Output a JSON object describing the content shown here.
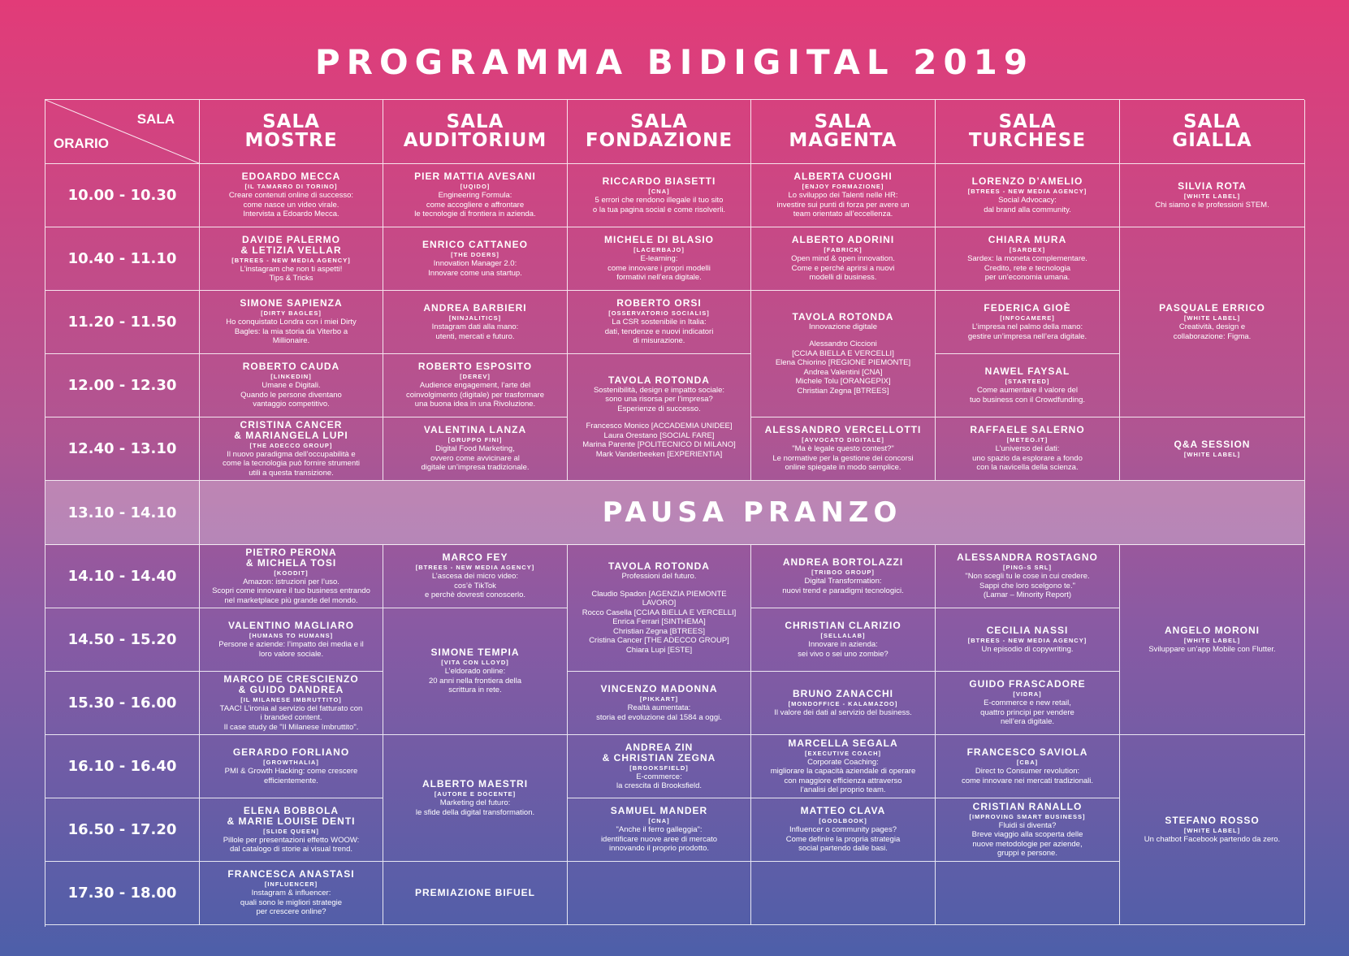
{
  "title": "PROGRAMMA BIDIGITAL 2019",
  "corner": {
    "sala": "SALA",
    "orario": "ORARIO"
  },
  "rooms": [
    [
      "SALA",
      "MOSTRE"
    ],
    [
      "SALA",
      "AUDITORIUM"
    ],
    [
      "SALA",
      "FONDAZIONE"
    ],
    [
      "SALA",
      "MAGENTA"
    ],
    [
      "SALA",
      "TURCHESE"
    ],
    [
      "SALA",
      "GIALLA"
    ]
  ],
  "times": [
    "10.00 - 10.30",
    "10.40 - 11.10",
    "11.20 - 11.50",
    "12.00 - 12.30",
    "12.40 - 13.10",
    "13.10 - 14.10",
    "14.10 - 14.40",
    "14.50 - 15.20",
    "15.30 - 16.00",
    "16.10 - 16.40",
    "16.50 - 17.20",
    "17.30 - 18.00"
  ],
  "lunch": "PAUSA PRANZO",
  "sessions": {
    "mostre_1": {
      "name": [
        "EDOARDO MECCA"
      ],
      "company": "[IL TAMARRO DI TORINO]",
      "desc": [
        "Creare contenuti online di successo:",
        "come nasce un video virale.",
        "Intervista a Edoardo Mecca."
      ]
    },
    "mostre_2": {
      "name": [
        "DAVIDE PALERMO",
        "& LETIZIA VELLAR"
      ],
      "company": "[BTREES - NEW MEDIA AGENCY]",
      "desc": [
        "L’instagram che non ti aspetti!",
        "Tips & Tricks"
      ]
    },
    "mostre_3": {
      "name": [
        "SIMONE SAPIENZA"
      ],
      "company": "[DIRTY BAGLES]",
      "desc": [
        "Ho conquistato Londra con i miei Dirty",
        "Bagles: la mia storia da Viterbo a",
        "Millionaire."
      ]
    },
    "mostre_4": {
      "name": [
        "ROBERTO CAUDA"
      ],
      "company": "[LINKEDIN]",
      "desc": [
        "Umane e Digitali.",
        "Quando le persone diventano",
        "vantaggio competitivo."
      ]
    },
    "mostre_5": {
      "name": [
        "CRISTINA CANCER",
        "& MARIANGELA LUPI"
      ],
      "company": "[THE ADECCO GROUP]",
      "desc": [
        "Il nuovo paradigma dell’occupabilità e",
        "come la tecnologia può fornire strumenti",
        "utili a questa transizione."
      ]
    },
    "mostre_7": {
      "name": [
        "PIETRO PERONA",
        "& MICHELA TOSI"
      ],
      "company": "[KOODIT]",
      "desc": [
        "Amazon: istruzioni per l’uso.",
        "Scopri come innovare il tuo business entrando",
        "nel marketplace più grande del mondo."
      ]
    },
    "mostre_8": {
      "name": [
        "VALENTINO MAGLIARO"
      ],
      "company": "[HUMANS TO HUMANS]",
      "desc": [
        "Persone e aziende: l’impatto dei media e il",
        "loro valore sociale."
      ]
    },
    "mostre_9": {
      "name": [
        "MARCO DE CRESCIENZO",
        "& GUIDO DANDREA"
      ],
      "company": "[IL MILANESE IMBRUTTITO]",
      "desc": [
        "TAAC! L’ironia al servizio del fatturato con",
        "i branded content.",
        "Il case study de \"Il Milanese Imbruttito\"."
      ]
    },
    "mostre_10": {
      "name": [
        "GERARDO FORLIANO"
      ],
      "company": "[GROWTHALIA]",
      "desc": [
        "PMI & Growth Hacking: come crescere",
        "efficientemente."
      ]
    },
    "mostre_11": {
      "name": [
        "ELENA BOBBOLA",
        "& MARIE LOUISE DENTI"
      ],
      "company": "[SLIDE QUEEN]",
      "desc": [
        "Pillole per presentazioni effetto WOOW:",
        "dal catalogo di storie ai visual trend."
      ]
    },
    "mostre_12": {
      "name": [
        "FRANCESCA ANASTASI"
      ],
      "company": "[INFLUENCER]",
      "desc": [
        "Instagram & influencer:",
        "quali sono le migliori strategie",
        "per crescere online?"
      ]
    },
    "aud_1": {
      "name": [
        "PIER MATTIA AVESANI"
      ],
      "company": "[UQIDO]",
      "desc": [
        "Engineering Formula:",
        "come accogliere e affrontare",
        "le tecnologie di frontiera in azienda."
      ]
    },
    "aud_2": {
      "name": [
        "ENRICO CATTANEO"
      ],
      "company": "[THE DOERS]",
      "desc": [
        "Innovation Manager 2.0:",
        "Innovare come una startup."
      ]
    },
    "aud_3": {
      "name": [
        "ANDREA BARBIERI"
      ],
      "company": "[NINJALITICS]",
      "desc": [
        "Instagram dati alla mano:",
        "utenti, mercati e futuro."
      ]
    },
    "aud_4": {
      "name": [
        "ROBERTO ESPOSITO"
      ],
      "company": "[DEREV]",
      "desc": [
        "Audience engagement, l’arte del",
        "coinvolgimento (digitale) per trasformare",
        "una buona idea in una Rivoluzione."
      ]
    },
    "aud_5": {
      "name": [
        "VALENTINA LANZA"
      ],
      "company": "[GRUPPO FINI]",
      "desc": [
        "Digital Food Marketing,",
        "ovvero come avvicinare al",
        "digitale un’impresa tradizionale."
      ]
    },
    "aud_7": {
      "name": [
        "MARCO FEY"
      ],
      "company": "[BTREES - NEW MEDIA AGENCY]",
      "desc": [
        "L’ascesa dei micro video:",
        "cos’è TikTok",
        "e perchè dovresti conoscerlo."
      ]
    },
    "aud_8": {
      "name": [
        "SIMONE TEMPIA"
      ],
      "company": "[VITA CON LLOYD]",
      "desc": [
        "L’eldorado online:",
        "20 anni nella frontiera della",
        "scrittura in rete."
      ]
    },
    "aud_10": {
      "name": [
        "ALBERTO MAESTRI"
      ],
      "company": "[AUTORE E DOCENTE]",
      "desc": [
        "Marketing del futuro:",
        "le sfide della digital transformation."
      ]
    },
    "aud_12": {
      "name": [
        "PREMIAZIONE BIFUEL"
      ],
      "company": "",
      "desc": []
    },
    "fond_1": {
      "name": [
        "RICCARDO BIASETTI"
      ],
      "company": "[CNA]",
      "desc": [
        "5 errori che rendono illegale il tuo sito",
        "o la tua pagina social e come risolverli."
      ]
    },
    "fond_2": {
      "name": [
        "MICHELE DI BLASIO"
      ],
      "company": "[LACERBAJO]",
      "desc": [
        "E-learning:",
        "come innovare i propri modelli",
        "formativi nell’era digitale."
      ]
    },
    "fond_3": {
      "name": [
        "ROBERTO ORSI"
      ],
      "company": "[OSSERVATORIO SOCIALIS]",
      "desc": [
        "La CSR sostenibile in Italia:",
        "dati, tendenze e nuovi indicatori",
        "di misurazione."
      ]
    },
    "fond_4": {
      "name": [
        "TAVOLA ROTONDA"
      ],
      "company": "",
      "desc": [
        "Sostenibilità, design e impatto sociale:",
        "sono una risorsa per l’impresa?",
        "Esperienze di successo.",
        "",
        "Francesco Monico [ACCADEMIA UNIDEE]",
        "Laura Orestano [SOCIAL FARE]",
        "Marina Parente [POLITECNICO DI MILANO]",
        "Mark Vanderbeeken [EXPERIENTIA]"
      ]
    },
    "fond_7": {
      "name": [
        "TAVOLA ROTONDA"
      ],
      "company": "",
      "desc": [
        "Professioni del futuro.",
        "",
        "Claudio Spadon [AGENZIA PIEMONTE",
        "LAVORO]",
        "Rocco Casella [CCIAA BIELLA E VERCELLI]",
        "Enrica Ferrari [SINTHEMA]",
        "Christian Zegna [BTREES]",
        "Cristina Cancer [THE ADECCO GROUP]",
        "Chiara Lupi [ESTE]"
      ]
    },
    "fond_9": {
      "name": [
        "VINCENZO MADONNA"
      ],
      "company": "[PIKKART]",
      "desc": [
        "Realtà aumentata:",
        "storia ed evoluzione dal 1584 a oggi."
      ]
    },
    "fond_10": {
      "name": [
        "ANDREA ZIN",
        "& CHRISTIAN ZEGNA"
      ],
      "company": "[BROOKSFIELD]",
      "desc": [
        "E-commerce:",
        "la crescita di Brooksfield."
      ]
    },
    "fond_11": {
      "name": [
        "SAMUEL MANDER"
      ],
      "company": "[CNA]",
      "desc": [
        "\"Anche il ferro galleggia\":",
        "identificare nuove aree di mercato",
        "innovando il proprio prodotto."
      ]
    },
    "mag_1": {
      "name": [
        "ALBERTA CUOGHI"
      ],
      "company": "[ENJOY FORMAZIONE]",
      "desc": [
        "Lo sviluppo dei Talenti nelle HR:",
        "investire sui punti di forza per avere un",
        "team orientato all’eccellenza."
      ]
    },
    "mag_2": {
      "name": [
        "ALBERTO ADORINI"
      ],
      "company": "[FABRICK]",
      "desc": [
        "Open mind & open innovation.",
        "Come e perché aprirsi a nuovi",
        "modelli di business."
      ]
    },
    "mag_3": {
      "name": [
        "TAVOLA ROTONDA"
      ],
      "company": "",
      "desc": [
        "Innovazione digitale",
        "",
        "Alessandro Ciccioni",
        "[CCIAA BIELLA E VERCELLI]",
        "Elena Chiorino [REGIONE PIEMONTE]",
        "Andrea Valentini [CNA]",
        "Michele Tolu [ORANGEPIX]",
        "Christian Zegna [BTREES]"
      ]
    },
    "mag_5": {
      "name": [
        "ALESSANDRO VERCELLOTTI"
      ],
      "company": "[AVVOCATO DIGITALE]",
      "desc": [
        "\"Ma è legale questo contest?\"",
        "Le normative per la gestione dei concorsi",
        "online spiegate in modo semplice."
      ]
    },
    "mag_7": {
      "name": [
        "ANDREA BORTOLAZZI"
      ],
      "company": "[TRIBOO GROUP]",
      "desc": [
        "Digital Transformation:",
        "nuovi trend e paradigmi tecnologici."
      ]
    },
    "mag_8": {
      "name": [
        "CHRISTIAN CLARIZIO"
      ],
      "company": "[SELLALAB]",
      "desc": [
        "Innovare in azienda:",
        "sei vivo o sei uno zombie?"
      ]
    },
    "mag_9": {
      "name": [
        "BRUNO ZANACCHI"
      ],
      "company": "[MONDOFFICE - KALAMAZOO]",
      "desc": [
        "Il valore dei dati al servizio del business."
      ]
    },
    "mag_10": {
      "name": [
        "MARCELLA SEGALA"
      ],
      "company": "[EXECUTIVE COACH]",
      "desc": [
        "Corporate Coaching:",
        "migliorare la capacità aziendale di operare",
        "con maggiore efficienza attraverso",
        "l’analisi del proprio team."
      ]
    },
    "mag_11": {
      "name": [
        "MATTEO CLAVA"
      ],
      "company": "[GOOLBOOK]",
      "desc": [
        "Influencer o community pages?",
        "Come definire la propria strategia",
        "social partendo dalle basi."
      ]
    },
    "turch_1": {
      "name": [
        "LORENZO D’AMELIO"
      ],
      "company": "[BTREES - NEW MEDIA AGENCY]",
      "desc": [
        "Social Advocacy:",
        "dal brand alla community."
      ]
    },
    "turch_2": {
      "name": [
        "CHIARA MURA"
      ],
      "company": "[SARDEX]",
      "desc": [
        "Sardex: la moneta complementare.",
        "Credito, rete e tecnologia",
        "per un’economia umana."
      ]
    },
    "turch_3": {
      "name": [
        "FEDERICA GIOÈ"
      ],
      "company": "[INFOCAMERE]",
      "desc": [
        "L’impresa nel palmo della mano:",
        "gestire un’impresa nell’era digitale."
      ]
    },
    "turch_4": {
      "name": [
        "NAWEL FAYSAL"
      ],
      "company": "[STARTEED]",
      "desc": [
        "Come aumentare il valore del",
        "tuo business con il Crowdfunding."
      ]
    },
    "turch_5": {
      "name": [
        "RAFFAELE SALERNO"
      ],
      "company": "[METEO.IT]",
      "desc": [
        "L’universo dei dati:",
        "uno spazio da esplorare a fondo",
        "con la navicella della scienza."
      ]
    },
    "turch_7": {
      "name": [
        "ALESSANDRA ROSTAGNO"
      ],
      "company": "[PING-S SRL]",
      "desc": [
        "\"Non scegli tu le cose in cui credere.",
        "Sappi che loro scelgono te.\"",
        "(Lamar – Minority Report)"
      ]
    },
    "turch_8": {
      "name": [
        "CECILIA NASSI"
      ],
      "company": "[BTREES - NEW MEDIA AGENCY]",
      "desc": [
        "Un episodio di copywriting."
      ]
    },
    "turch_9": {
      "name": [
        "GUIDO FRASCADORE"
      ],
      "company": "[VIDRA]",
      "desc": [
        "E-commerce e new retail,",
        "quattro principi per vendere",
        "nell’era digitale."
      ]
    },
    "turch_10": {
      "name": [
        "FRANCESCO SAVIOLA"
      ],
      "company": "[CBA]",
      "desc": [
        "Direct to Consumer revolution:",
        "come innovare nei mercati tradizionali."
      ]
    },
    "turch_11": {
      "name": [
        "CRISTIAN RANALLO"
      ],
      "company": "[IMPROVING SMART BUSINESS]",
      "desc": [
        "Fluidi si diventa?",
        "Breve viaggio alla scoperta delle",
        "nuove metodologie per aziende,",
        "gruppi e persone."
      ]
    },
    "gia_1": {
      "name": [
        "SILVIA ROTA"
      ],
      "company": "[WHITE LABEL]",
      "desc": [
        "Chi siamo e le professioni STEM."
      ]
    },
    "gia_2": {
      "name": [
        "PASQUALE ERRICO"
      ],
      "company": "[WHITE LABEL]",
      "desc": [
        "Creatività, design e",
        "collaborazione: Figma."
      ]
    },
    "gia_5": {
      "name": [
        "Q&A SESSION"
      ],
      "company": "[WHITE LABEL]",
      "desc": []
    },
    "gia_7": {
      "name": [
        "ANGELO MORONI"
      ],
      "company": "[WHITE LABEL]",
      "desc": [
        "Sviluppare un’app Mobile con Flutter."
      ]
    },
    "gia_10": {
      "name": [
        "STEFANO ROSSO"
      ],
      "company": "[WHITE LABEL]",
      "desc": [
        "Un chatbot Facebook partendo da zero."
      ]
    }
  }
}
